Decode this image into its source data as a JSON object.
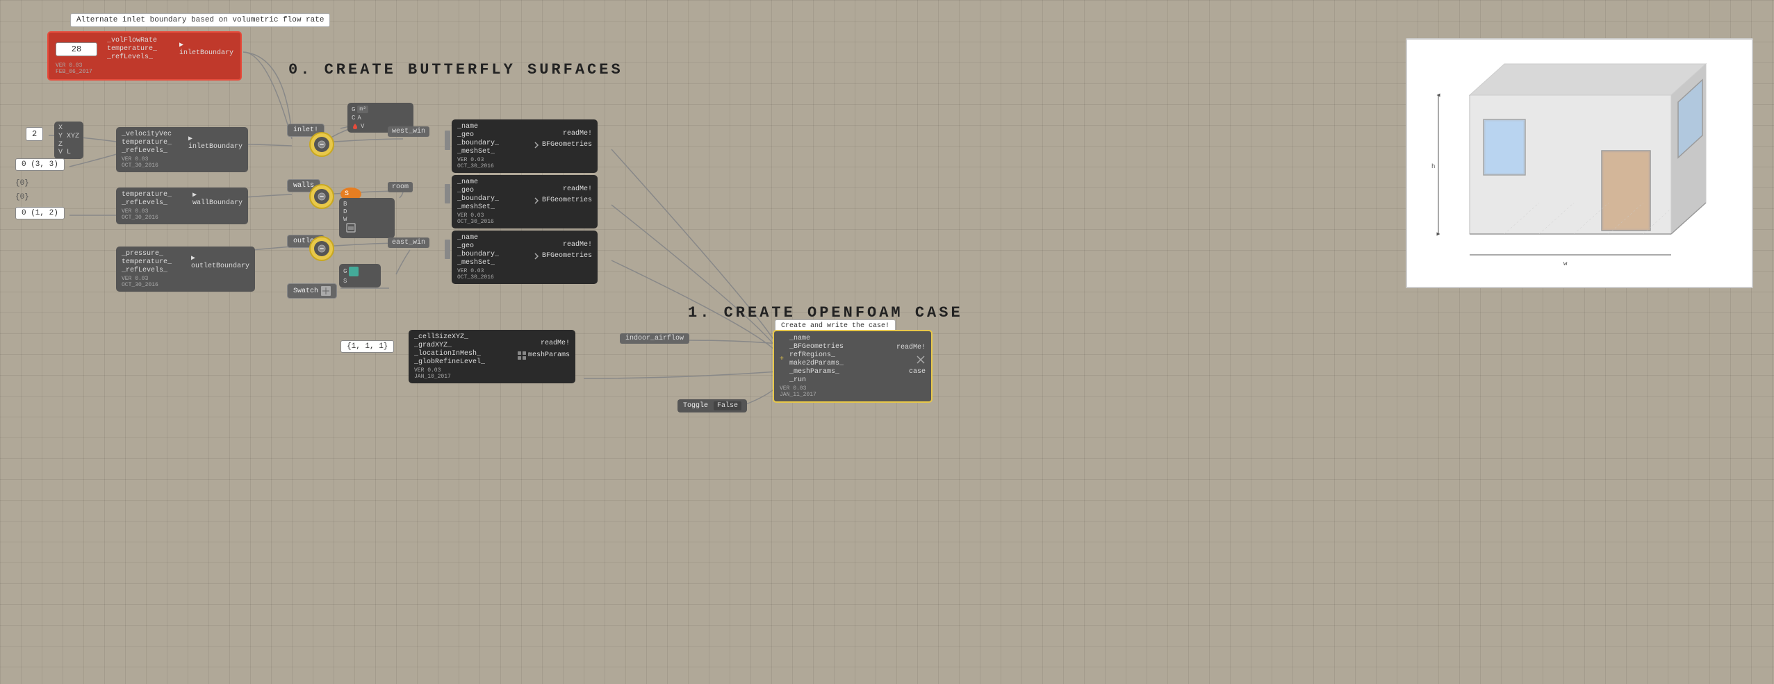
{
  "tooltip": "Alternate inlet boundary based on volumetric flow rate",
  "sections": {
    "create_butterfly": "0.  CREATE BUTTERFLY SURFACES",
    "create_openfoam": "1.  CREATE OPENFOAM CASE"
  },
  "nodes": {
    "vol_flow_rate": {
      "input_val": "28",
      "labels": [
        "_volFlowRate",
        "temperature_",
        "_refLevels_"
      ],
      "output": "inletBoundary",
      "version": "VER 0.03",
      "date": "FEB_06_2017"
    },
    "velocity_vec": {
      "inputs": [
        "X",
        "Y XYZ",
        "Z"
      ],
      "input_val1": "2",
      "input_val2": "0 (3, 3)",
      "labels": [
        "_velocityVec",
        "temperature_",
        "_refLevels_"
      ],
      "output": "inletBoundary",
      "version": "VER 0.03",
      "date": "OCT_30_2016"
    },
    "wall_boundary": {
      "input_val": "0 (1, 2)",
      "labels": [
        "temperature_",
        "_refLevels_"
      ],
      "output": "wallBoundary",
      "version": "VER 0.03",
      "date": "OCT_30_2016"
    },
    "outlet_boundary": {
      "labels": [
        "_pressure_",
        "temperature_",
        "_refLevels_"
      ],
      "output": "outletBoundary",
      "version": "VER 0.03",
      "date": "OCT_30_2016"
    },
    "west_win": {
      "label": "west_win",
      "sub_labels": [
        "_name",
        "_geo",
        "_boundary_",
        "_meshSet_"
      ],
      "output": "BFGeometries",
      "readMe": "readMe!",
      "version": "VER 0.03",
      "date": "OCT_30_2016"
    },
    "room": {
      "label": "room",
      "sub_labels": [
        "_name",
        "_geo",
        "_boundary_",
        "_meshSet_"
      ],
      "output": "BFGeometries",
      "readMe": "readMe!",
      "version": "VER 0.03",
      "date": "OCT_30_2016"
    },
    "east_win": {
      "label": "east_win",
      "sub_labels": [
        "_name",
        "_geo",
        "_boundary_",
        "_meshSet_"
      ],
      "output": "BFGeometries",
      "readMe": "readMe!",
      "version": "VER 0.03",
      "date": "OCT_30_2016"
    },
    "mesh_params": {
      "input_val": "{1, 1, 1}",
      "labels": [
        "_cellSizeXYZ_",
        "_gradXYZ_",
        "_locationInMesh_",
        "_globRefineLevel_"
      ],
      "readMe": "readMe!",
      "output": "meshParams",
      "version": "VER 0.03",
      "date": "JAN_10_2017"
    },
    "openfoam_case": {
      "tooltip": "Create and write the case!",
      "labels": [
        "_name",
        "_BFGeometries",
        "refRegions_",
        "make2dParams_",
        "_meshParams_",
        "_run"
      ],
      "readMe": "readMe!",
      "output": "case",
      "version": "VER 0.03",
      "date": "JAN_11_2017"
    },
    "indoor_airflow": {
      "label": "indoor_airflow"
    },
    "toggle": {
      "label": "Toggle",
      "value": "False"
    }
  },
  "buttons": {
    "inlet": "inlet!",
    "walls": "walls",
    "outlet": "outlet",
    "swatch": "Swatch"
  },
  "grasshopper_nodes": {
    "g_node1": {
      "labels": [
        "G",
        "m²",
        "A",
        "C",
        "A",
        "V"
      ]
    },
    "b_node": {
      "labels": [
        "B",
        "D",
        "W"
      ]
    },
    "g_node2": {
      "labels": [
        "G",
        "S"
      ]
    }
  },
  "colors": {
    "background": "#b0a898",
    "node_dark": "#2d2d2d",
    "node_mid": "#4a4a4a",
    "node_light": "#666",
    "accent_yellow": "#e8c84a",
    "accent_red": "#c0392b",
    "text_light": "#ddd",
    "text_dim": "#999"
  }
}
